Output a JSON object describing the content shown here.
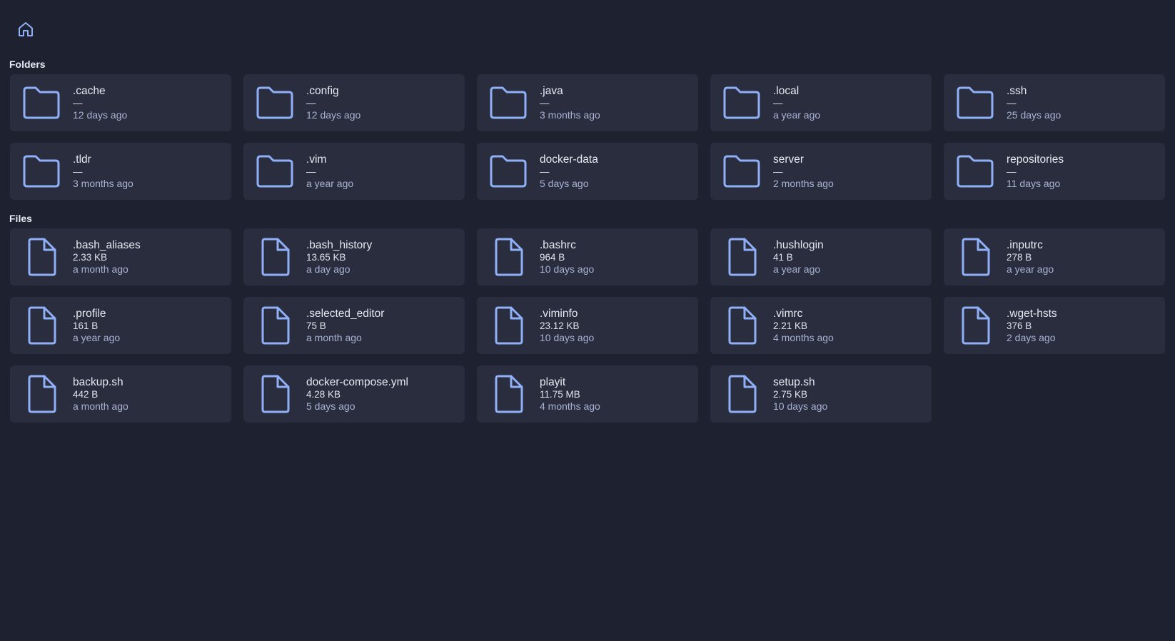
{
  "nav": {
    "home_icon": "home-icon"
  },
  "sections": {
    "folders_title": "Folders",
    "files_title": "Files"
  },
  "folders": [
    {
      "name": ".cache",
      "size": "—",
      "modified": "12 days ago"
    },
    {
      "name": ".config",
      "size": "—",
      "modified": "12 days ago"
    },
    {
      "name": ".java",
      "size": "—",
      "modified": "3 months ago"
    },
    {
      "name": ".local",
      "size": "—",
      "modified": "a year ago"
    },
    {
      "name": ".ssh",
      "size": "—",
      "modified": "25 days ago"
    },
    {
      "name": ".tldr",
      "size": "—",
      "modified": "3 months ago"
    },
    {
      "name": ".vim",
      "size": "—",
      "modified": "a year ago"
    },
    {
      "name": "docker-data",
      "size": "—",
      "modified": "5 days ago"
    },
    {
      "name": "server",
      "size": "—",
      "modified": "2 months ago"
    },
    {
      "name": "repositories",
      "size": "—",
      "modified": "11 days ago"
    }
  ],
  "files": [
    {
      "name": ".bash_aliases",
      "size": "2.33 KB",
      "modified": "a month ago"
    },
    {
      "name": ".bash_history",
      "size": "13.65 KB",
      "modified": "a day ago"
    },
    {
      "name": ".bashrc",
      "size": "964 B",
      "modified": "10 days ago"
    },
    {
      "name": ".hushlogin",
      "size": "41 B",
      "modified": "a year ago"
    },
    {
      "name": ".inputrc",
      "size": "278 B",
      "modified": "a year ago"
    },
    {
      "name": ".profile",
      "size": "161 B",
      "modified": "a year ago"
    },
    {
      "name": ".selected_editor",
      "size": "75 B",
      "modified": "a month ago"
    },
    {
      "name": ".viminfo",
      "size": "23.12 KB",
      "modified": "10 days ago"
    },
    {
      "name": ".vimrc",
      "size": "2.21 KB",
      "modified": "4 months ago"
    },
    {
      "name": ".wget-hsts",
      "size": "376 B",
      "modified": "2 days ago"
    },
    {
      "name": "backup.sh",
      "size": "442 B",
      "modified": "a month ago"
    },
    {
      "name": "docker-compose.yml",
      "size": "4.28 KB",
      "modified": "5 days ago"
    },
    {
      "name": "playit",
      "size": "11.75 MB",
      "modified": "4 months ago"
    },
    {
      "name": "setup.sh",
      "size": "2.75 KB",
      "modified": "10 days ago"
    }
  ],
  "colors": {
    "background": "#1e2130",
    "card": "#2a2d3e",
    "accent": "#8fb0f7",
    "date_text": "#a8b3d4"
  }
}
